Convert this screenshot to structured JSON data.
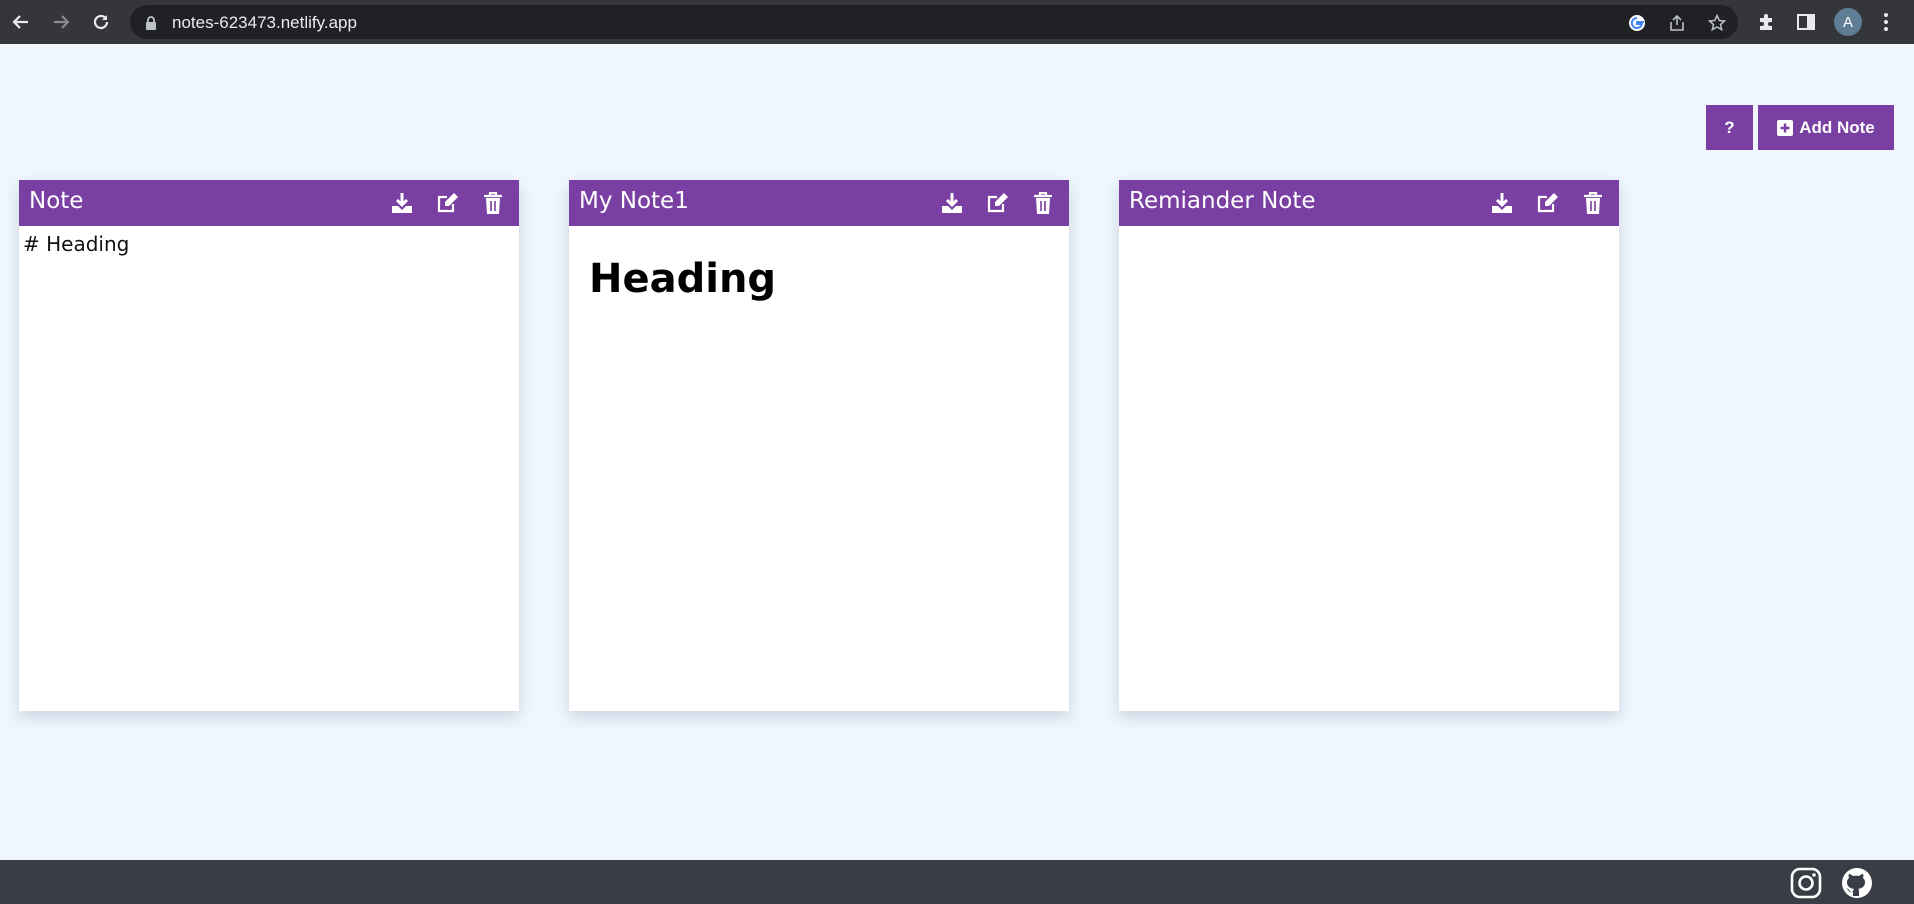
{
  "browser": {
    "url": "notes-623473.netlify.app",
    "profile_initial": "A",
    "icons": [
      "back-icon",
      "forward-icon",
      "reload-icon",
      "lock-icon",
      "google-icon",
      "share-icon",
      "star-icon",
      "extensions-icon",
      "side-panel-icon",
      "menu-icon"
    ]
  },
  "toolbar": {
    "help_label": "?",
    "add_note_label": "Add Note",
    "add_note_icon": "plus-square-icon"
  },
  "notes": [
    {
      "title": "Note",
      "content": "# Heading",
      "mode": "raw"
    },
    {
      "title": "My Note1",
      "content": "Heading",
      "mode": "rendered"
    },
    {
      "title": "Remiander Note",
      "content": "",
      "mode": "rendered"
    }
  ],
  "note_actions": [
    "download-icon",
    "edit-icon",
    "trash-icon"
  ],
  "footer": {
    "links": [
      "instagram-icon",
      "github-icon"
    ]
  },
  "colors": {
    "accent": "#7a3fa3",
    "page_background": "#eff6fe",
    "footer_background": "#393e46",
    "browser_chrome": "#35363a"
  }
}
